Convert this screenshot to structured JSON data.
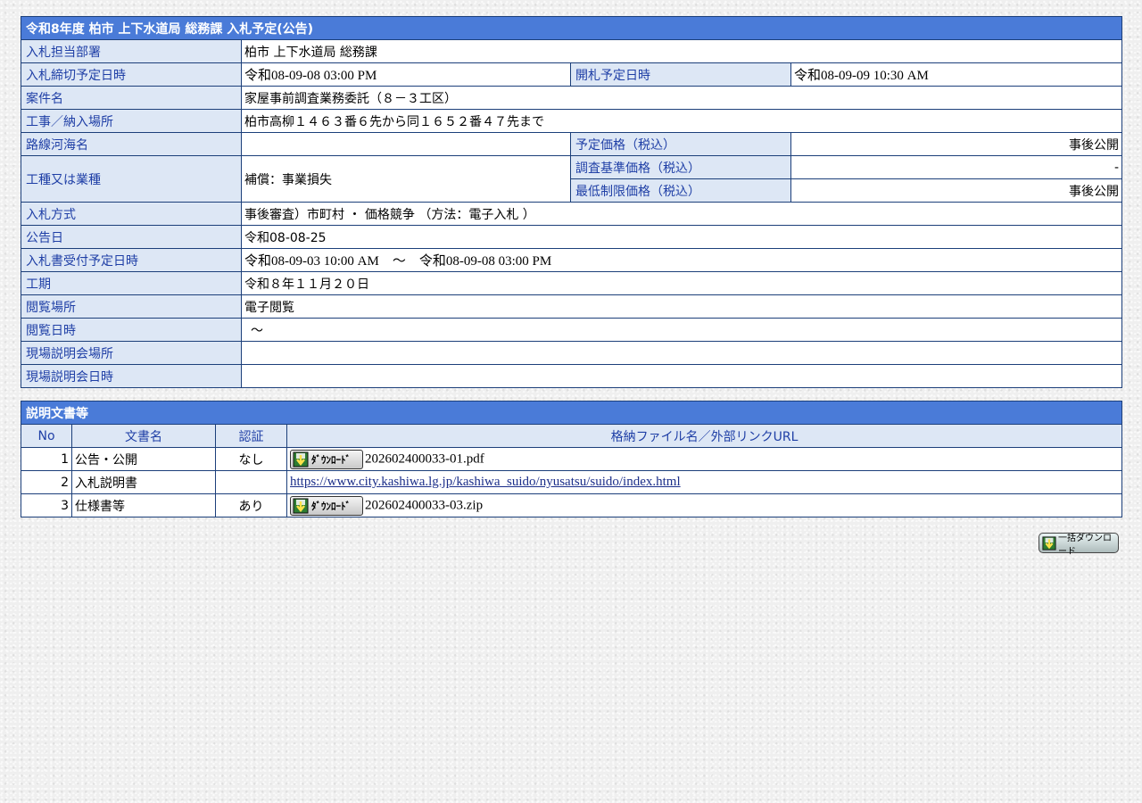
{
  "bid": {
    "title": "令和8年度  柏市  上下水道局  総務課  入札予定(公告)",
    "rows": {
      "dept": {
        "label": "入札担当部署",
        "value": "柏市  上下水道局  総務課"
      },
      "deadline": {
        "label": "入札締切予定日時",
        "value": "令和08-09-08 03:00 PM"
      },
      "opening": {
        "label": "開札予定日時",
        "value": "令和08-09-09 10:30 AM"
      },
      "project": {
        "label": "案件名",
        "value": "家屋事前調査業務委託（８－３工区）"
      },
      "location": {
        "label": "工事／納入場所",
        "value": "柏市高柳１４６３番６先から同１６５２番４７先まで"
      },
      "route": {
        "label": "路線河海名",
        "value": ""
      },
      "est_price": {
        "label": "予定価格（税込）",
        "value": "事後公開"
      },
      "type": {
        "label": "工種又は業種",
        "value": "補償：事業損失"
      },
      "base_price": {
        "label": "調査基準価格（税込）",
        "value": "-"
      },
      "min_price": {
        "label": "最低制限価格（税込）",
        "value": "事後公開"
      },
      "method": {
        "label": "入札方式",
        "value": "事後審査）市町村 ・ 価格競争 （方法：電子入札 ）"
      },
      "notice_date": {
        "label": "公告日",
        "value": "令和08-08-25"
      },
      "reception": {
        "label": "入札書受付予定日時",
        "value": "令和08-09-03 10:00 AM　～　令和08-09-08 03:00 PM"
      },
      "period": {
        "label": "工期",
        "value": "令和８年１１月２０日"
      },
      "view_place": {
        "label": "閲覧場所",
        "value": "電子閲覧"
      },
      "view_date": {
        "label": "閲覧日時",
        "value": "～"
      },
      "brief_place": {
        "label": "現場説明会場所",
        "value": ""
      },
      "brief_date": {
        "label": "現場説明会日時",
        "value": ""
      }
    }
  },
  "docs": {
    "title": "説明文書等",
    "headers": {
      "no": "No",
      "name": "文書名",
      "auth": "認証",
      "file": "格納ファイル名／外部リンクURL"
    },
    "download_label": "ﾀﾞｳﾝﾛｰﾄﾞ",
    "items": [
      {
        "no": "1",
        "name": "公告・公開",
        "auth": "なし",
        "file": "202602400033-01.pdf"
      },
      {
        "no": "2",
        "name": "入札説明書",
        "auth": "",
        "link": "https://www.city.kashiwa.lg.jp/kashiwa_suido/nyusatsu/suido/index.html"
      },
      {
        "no": "3",
        "name": "仕様書等",
        "auth": "あり",
        "file": "202602400033-03.zip"
      }
    ],
    "bulk_download_label": "一括ダウンロード"
  },
  "colors": {
    "title_bg": "#4a7bd8",
    "label_bg": "#dde7f5",
    "label_text": "#1f3fa6",
    "border": "#1c3f7a",
    "link": "#1c2f8a"
  }
}
